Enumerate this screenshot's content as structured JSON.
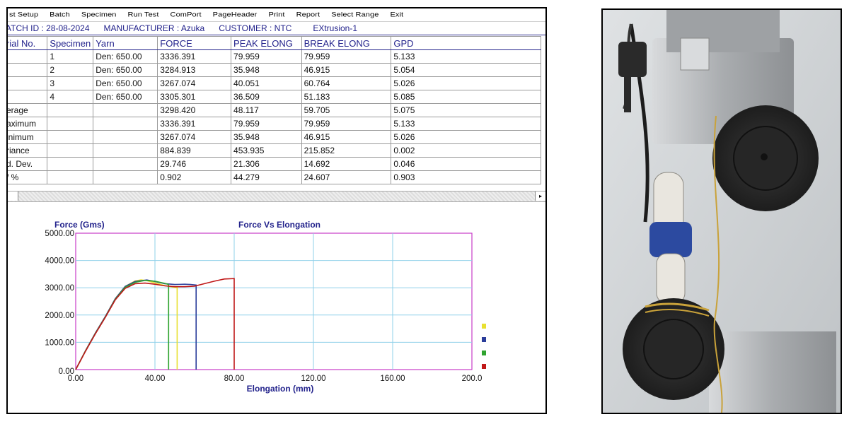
{
  "menu": [
    "st Setup",
    "Batch",
    "Specimen",
    "Run Test",
    "ComPort",
    "PageHeader",
    "Print",
    "Report",
    "Select Range",
    "Exit"
  ],
  "info": {
    "batch": "ATCH ID : 28-08-2024",
    "manufacturer": "MANUFACTURER : Azuka",
    "customer": "CUSTOMER : NTC",
    "process": "EXtrusion-1"
  },
  "table": {
    "headers": [
      "rial No.",
      "Specimen",
      "Yarn",
      "FORCE",
      "PEAK ELONG",
      "BREAK ELONG",
      "GPD"
    ],
    "rows": [
      [
        "",
        "1",
        "Den: 650.00",
        "3336.391",
        "79.959",
        "79.959",
        "5.133"
      ],
      [
        "",
        "2",
        "Den: 650.00",
        "3284.913",
        "35.948",
        "46.915",
        "5.054"
      ],
      [
        "",
        "3",
        "Den: 650.00",
        "3267.074",
        "40.051",
        "60.764",
        "5.026"
      ],
      [
        "",
        "4",
        "Den: 650.00",
        "3305.301",
        "36.509",
        "51.183",
        "5.085"
      ],
      [
        "erage",
        "",
        "",
        "3298.420",
        "48.117",
        "59.705",
        "5.075"
      ],
      [
        "aximum",
        "",
        "",
        "3336.391",
        "79.959",
        "79.959",
        "5.133"
      ],
      [
        "inimum",
        "",
        "",
        "3267.074",
        "35.948",
        "46.915",
        "5.026"
      ],
      [
        "riance",
        "",
        "",
        "884.839",
        "453.935",
        "215.852",
        "0.002"
      ],
      [
        "d. Dev.",
        "",
        "",
        "29.746",
        "21.306",
        "14.692",
        "0.046"
      ],
      [
        "/ %",
        "",
        "",
        "0.902",
        "44.279",
        "24.607",
        "0.903"
      ]
    ]
  },
  "scroll_right_icon": "▸",
  "chart_data": {
    "type": "line",
    "title": "Force Vs Elongation",
    "ylabel": "Force  (Gms)",
    "xlabel": "Elongation (mm)",
    "xlim": [
      0,
      200
    ],
    "ylim": [
      0,
      5000
    ],
    "x_ticks": [
      0,
      40,
      80,
      120,
      160,
      200
    ],
    "x_tick_labels": [
      "0.00",
      "40.00",
      "80.00",
      "120.00",
      "160.00",
      "200.0"
    ],
    "y_ticks": [
      0,
      1000,
      2000,
      3000,
      4000,
      5000
    ],
    "y_tick_labels": [
      "0.00",
      "1000.00",
      "2000.00",
      "3000.00",
      "4000.00",
      "5000.00"
    ],
    "grid": true,
    "series": [
      {
        "color": "#e8e030",
        "x": [
          0,
          5,
          10,
          15,
          20,
          25,
          30,
          33,
          36,
          40,
          45,
          50,
          51.2,
          51.2
        ],
        "y": [
          0,
          700,
          1350,
          1950,
          2600,
          3050,
          3250,
          3290,
          3260,
          3180,
          3080,
          3010,
          3000,
          0
        ]
      },
      {
        "color": "#2a3d9a",
        "x": [
          0,
          5,
          10,
          15,
          20,
          25,
          30,
          35.9,
          40,
          45,
          50,
          55,
          58,
          60.8,
          60.8
        ],
        "y": [
          0,
          700,
          1350,
          1950,
          2600,
          3050,
          3230,
          3285,
          3230,
          3150,
          3120,
          3130,
          3120,
          3100,
          0
        ]
      },
      {
        "color": "#2fa32f",
        "x": [
          0,
          5,
          10,
          15,
          20,
          25,
          30,
          35,
          40,
          45,
          46.9,
          46.9
        ],
        "y": [
          0,
          690,
          1330,
          1930,
          2580,
          3020,
          3200,
          3270,
          3240,
          3160,
          3120,
          0
        ]
      },
      {
        "color": "#c01818",
        "x": [
          0,
          5,
          10,
          15,
          20,
          25,
          30,
          35,
          40,
          45,
          50,
          55,
          60,
          65,
          70,
          75,
          80,
          80
        ],
        "y": [
          0,
          680,
          1320,
          1920,
          2560,
          2980,
          3150,
          3170,
          3130,
          3070,
          3040,
          3040,
          3060,
          3150,
          3240,
          3320,
          3336,
          0
        ]
      }
    ]
  },
  "photo": {
    "yarn_color": "#c9a23a",
    "upper_clamp_color": "#2d2d2d",
    "lower_clamp_color": "#2d2d2d",
    "metal_color": "#b4b6b8"
  }
}
